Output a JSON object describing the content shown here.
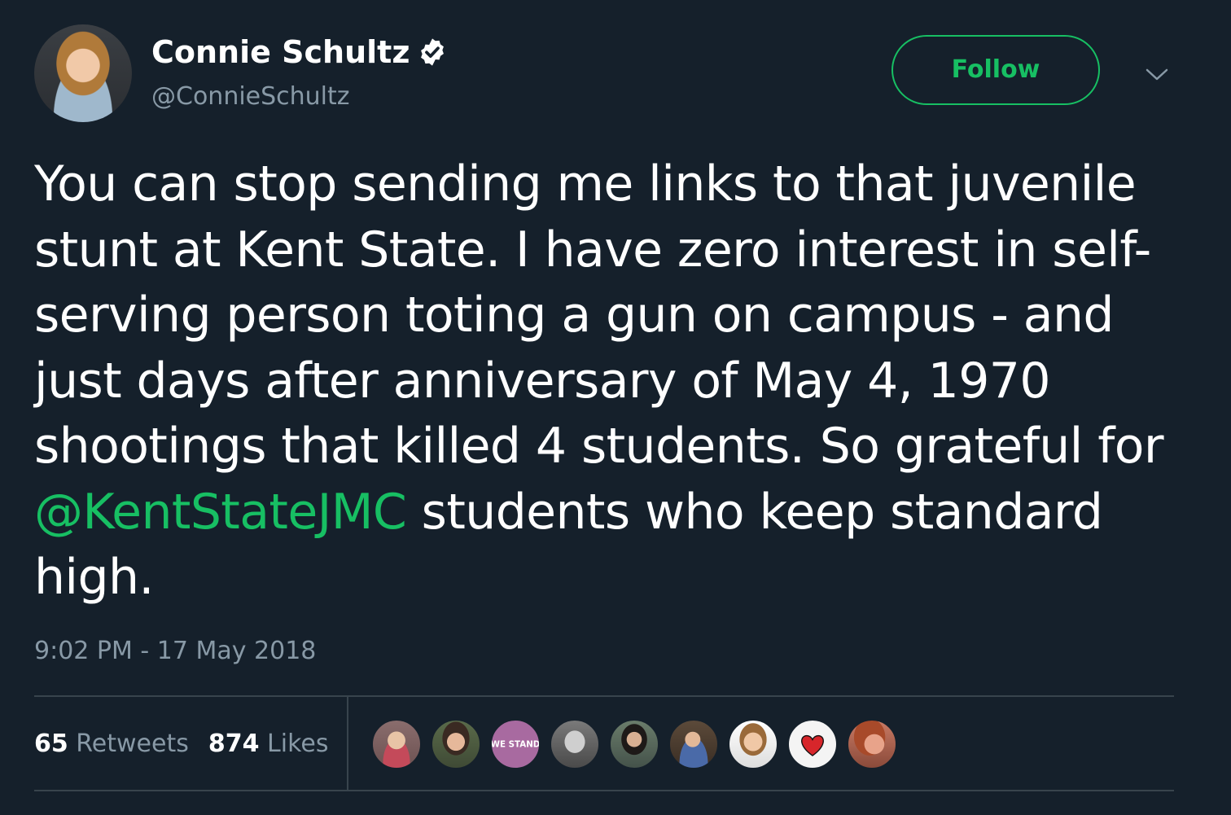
{
  "author": {
    "name": "Connie Schultz",
    "handle": "@ConnieSchultz",
    "verified": true,
    "avatar": "profile-photo"
  },
  "actions": {
    "follow_label": "Follow",
    "more_icon": "chevron-down-icon"
  },
  "tweet": {
    "text_before": "You can stop sending me links to that juvenile stunt at Kent State. I have zero interest in self-serving person toting a gun on campus - and just days after anniversary of May 4, 1970 shootings that killed 4 students. So grateful for ",
    "mention": "@KentStateJMC",
    "text_after": " students who keep standard high.",
    "timestamp": "9:02 PM - 17 May 2018"
  },
  "stats": {
    "retweets_count": "65",
    "retweets_label": "Retweets",
    "likes_count": "874",
    "likes_label": "Likes"
  },
  "likers": [
    {
      "avatar": "liker-avatar-1"
    },
    {
      "avatar": "liker-avatar-2"
    },
    {
      "avatar": "liker-avatar-3",
      "text": "WE STAND"
    },
    {
      "avatar": "liker-avatar-4"
    },
    {
      "avatar": "liker-avatar-5"
    },
    {
      "avatar": "liker-avatar-6"
    },
    {
      "avatar": "liker-avatar-7"
    },
    {
      "avatar": "liker-avatar-8"
    },
    {
      "avatar": "liker-avatar-9"
    }
  ],
  "colors": {
    "background": "#15202b",
    "accent": "#17bf63",
    "secondary_text": "#8899a6",
    "divider": "#38444d"
  }
}
